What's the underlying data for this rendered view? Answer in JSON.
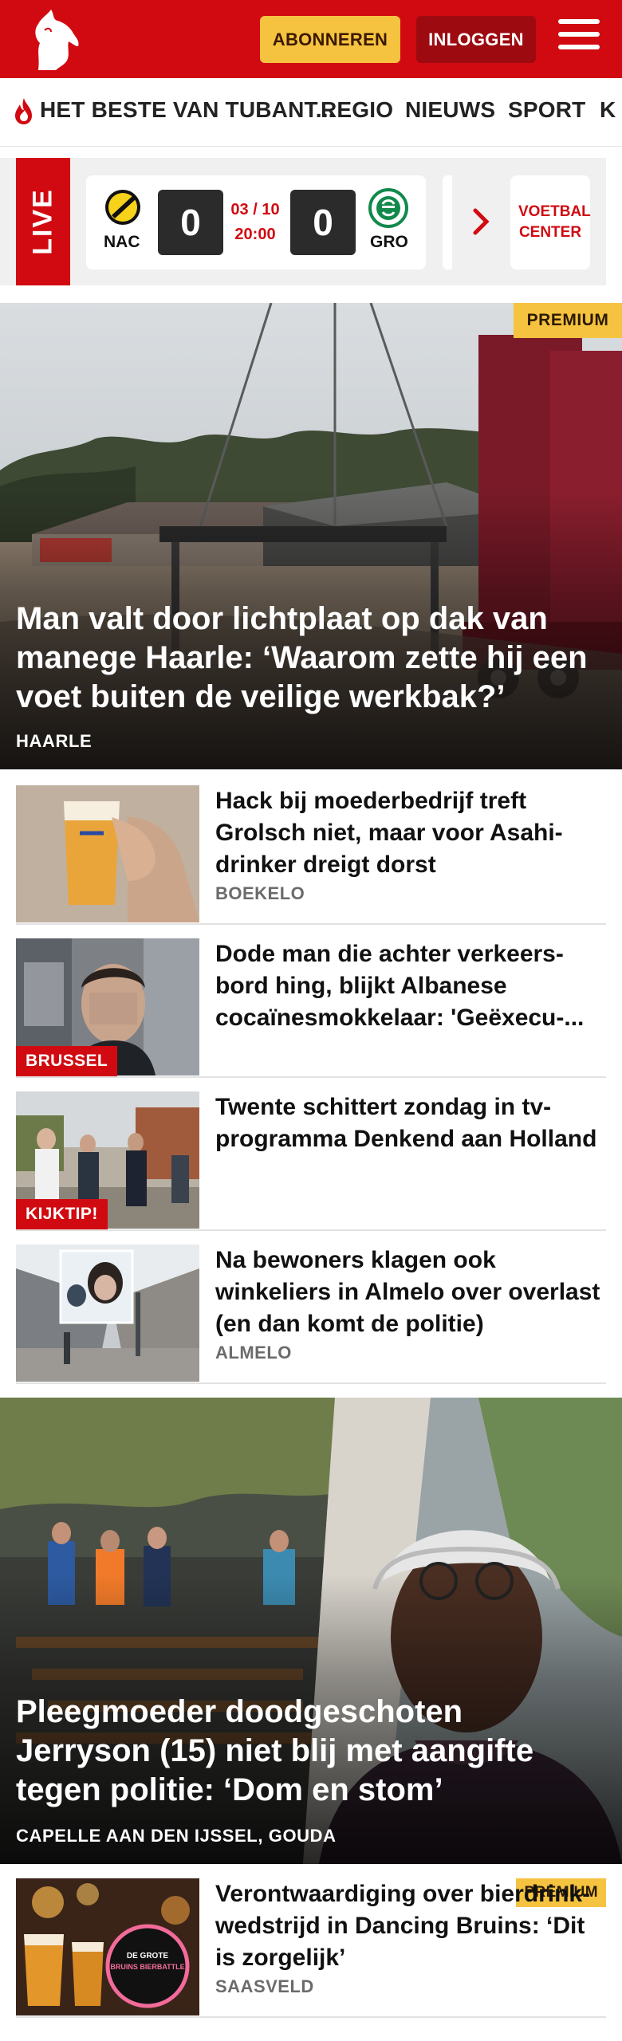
{
  "header": {
    "subscribe_label": "ABONNEREN",
    "login_label": "INLOGGEN",
    "brand_color": "#d10a11",
    "logo_icon": "horse-logo-icon",
    "menu_icon": "hamburger-menu-icon"
  },
  "nav": {
    "items": [
      {
        "label": "HET BESTE VAN TUBANT..."
      },
      {
        "label": "REGIO"
      },
      {
        "label": "NIEUWS"
      },
      {
        "label": "SPORT"
      },
      {
        "label": "K"
      }
    ]
  },
  "live": {
    "label": "LIVE",
    "match": {
      "home_team": "NAC",
      "home_score": "0",
      "date": "03 / 10",
      "time": "20:00",
      "away_score": "0",
      "away_team": "GRO"
    },
    "voetbal_center_label": "VOETBAL CENTER"
  },
  "hero": {
    "premium_label": "PREMIUM",
    "title": "Man valt door lichtplaat op dak van manege Haarle: ‘Waarom zette hij een voet buiten de veilige werkbak?’",
    "location": "HAARLE"
  },
  "articles": [
    {
      "title": "Hack bij moederbedrijf treft Grolsch niet, maar voor Asahi-drinker dreigt dorst",
      "location": "BOEKELO",
      "tag": ""
    },
    {
      "title": "Dode man die achter verkeers­bord hing, blijkt Albanese cocaïnesmokkelaar: 'Geëxecu-...",
      "location": "",
      "tag": "BRUSSEL"
    },
    {
      "title": "Twente schittert zondag in tv-programma Denkend aan Holland",
      "location": "",
      "tag": "KIJKTIP!"
    },
    {
      "title": "Na bewoners klagen ook winkeliers in Almelo over overlast (en dan komt de politie)",
      "location": "ALMELO",
      "tag": ""
    }
  ],
  "hero2": {
    "title": "Pleegmoeder doodgeschoten Jerryson (15) niet blij met aangifte tegen politie: ‘Dom en stom’",
    "location": "CAPELLE AAN DEN IJSSEL, GOUDA"
  },
  "article_premium": {
    "premium_label": "PREMIUM",
    "title": "Verontwaardiging over bierdrink­wedstrijd in Dancing Bruins: ‘Dit is zorgelijk’",
    "location": "SAASVELD",
    "thumb_text": "DE GROTE BRUINS BIERBATTLE"
  }
}
